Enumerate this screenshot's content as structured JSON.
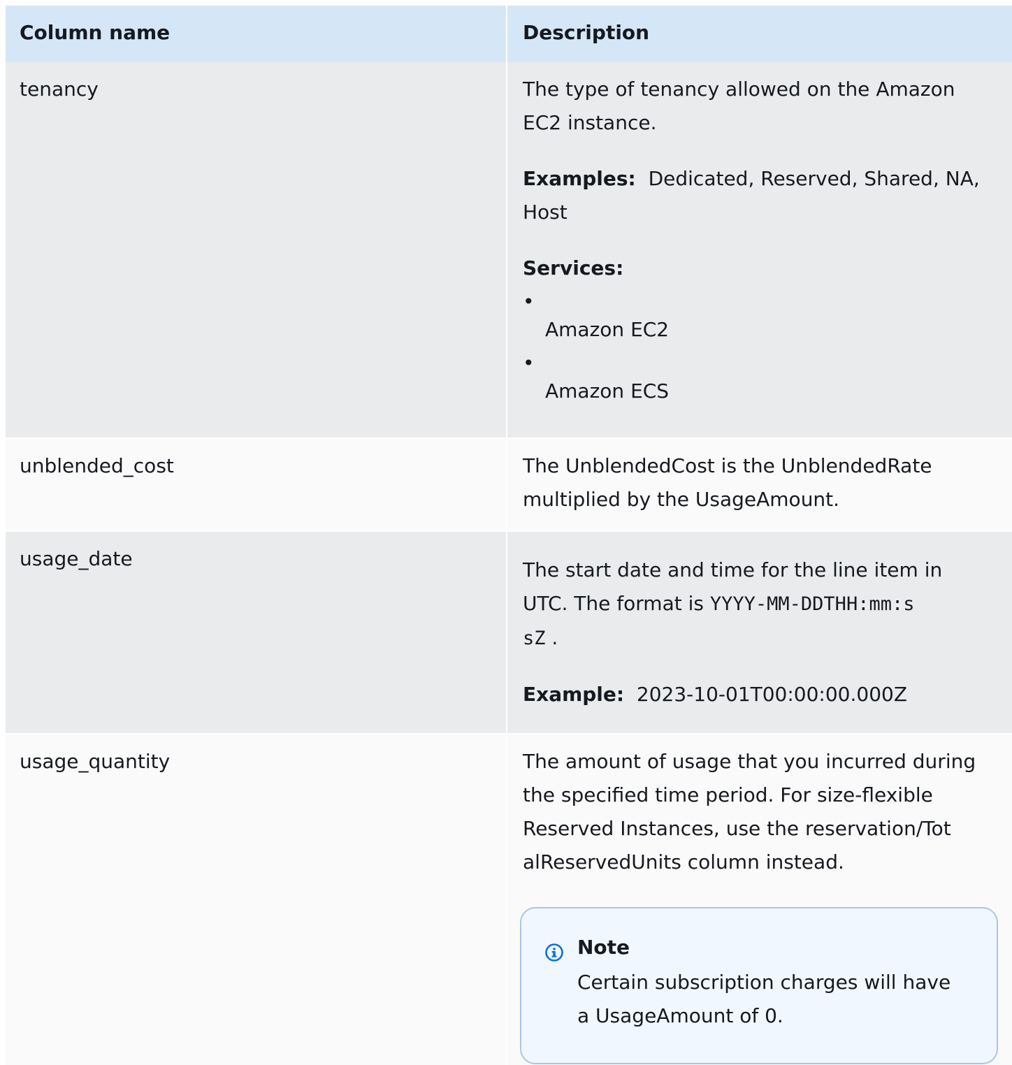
{
  "header": {
    "col1": "Column name",
    "col2": "Description"
  },
  "rows": [
    {
      "name": "tenancy",
      "desc_line1": "The type of tenancy allowed on the Amazon",
      "desc_line2": "EC2  instance.",
      "examples_label": "Examples:",
      "examples_line1": "Dedicated, Reserved, Shared, NA,",
      "examples_line2": "Host",
      "services_label": "Services:",
      "services": [
        "Amazon EC2",
        "Amazon ECS"
      ]
    },
    {
      "name": "unblended_cost",
      "desc_line1": "The UnblendedCost is the UnblendedRate",
      "desc_line2": "multiplied by the  UsageAmount."
    },
    {
      "name": "usage_date",
      "desc_line1": "The start date and time for the line item in",
      "desc_line2_text": "UTC. The format  is ",
      "desc_line2_code": "YYYY-MM-DDTHH:mm:s",
      "desc_line3_code": "sZ",
      "desc_line3_text": " .",
      "example_label": "Example:",
      "example_value": "2023-10-01T00:00:00.000Z"
    },
    {
      "name": "usage_quantity",
      "desc_line1": "The amount of usage that you incurred during",
      "desc_line2": "the specified time  period. For size-flexible",
      "desc_line3": "Reserved Instances, use the  reservation/Tot",
      "desc_line4": "alReservedUnits column instead.",
      "note_title": "Note",
      "note_line1": "Certain subscription charges will have",
      "note_line2": "a UsageAmount of  0."
    }
  ],
  "colors": {
    "header_bg": "#d5e6f7",
    "row_gray": "#e9ebed",
    "row_light": "#fafafa",
    "note_bg": "#f0f7ff",
    "note_border": "#a8c7e6",
    "info_icon": "#0972d3"
  },
  "icons": {
    "note_icon": "info-icon"
  }
}
